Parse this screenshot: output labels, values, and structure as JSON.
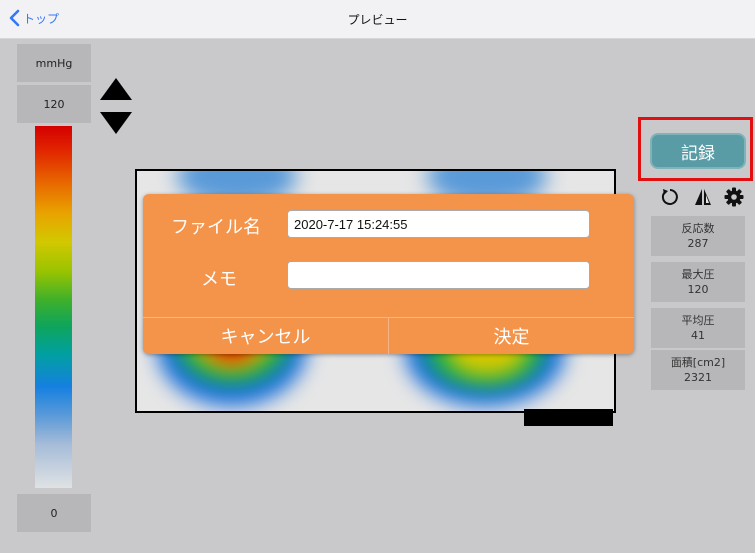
{
  "nav": {
    "back_label": "トップ",
    "title": "プレビュー"
  },
  "scale": {
    "unit": "mmHg",
    "max": "120",
    "min": "0"
  },
  "record": {
    "label": "記録",
    "highlight_color": "#e01010",
    "button_color": "#5a9ca5"
  },
  "tools": [
    "rotate-icon",
    "flip-icon",
    "gear-icon"
  ],
  "stats": [
    {
      "label": "反応数",
      "value": "287"
    },
    {
      "label": "最大圧",
      "value": "120"
    },
    {
      "label": "平均圧",
      "value": "41"
    },
    {
      "label": "面積[cm2]",
      "value": "2321"
    }
  ],
  "dialog": {
    "filename_label": "ファイル名",
    "filename_value": "2020-7-17 15:24:55",
    "memo_label": "メモ",
    "memo_value": "",
    "cancel_label": "キャンセル",
    "ok_label": "決定",
    "color": "#f4934a"
  }
}
